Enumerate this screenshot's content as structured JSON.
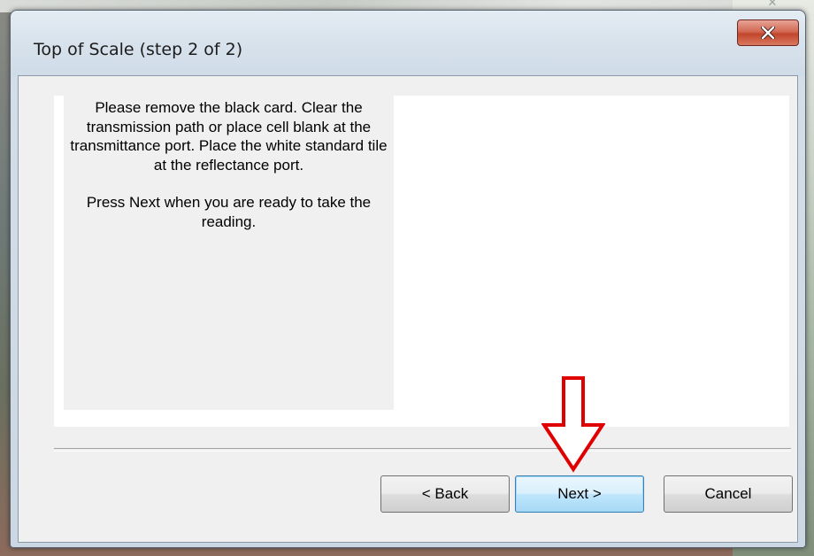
{
  "window": {
    "title": "Top of Scale (step 2 of 2)"
  },
  "instructions": {
    "paragraph1": "Please remove the black card.  Clear the transmission path or place cell blank at the transmittance port.  Place the white standard tile at the reflectance port.",
    "paragraph2": "Press Next when you are ready to take the reading."
  },
  "buttons": {
    "back_label": "< Back",
    "next_label": "Next >",
    "cancel_label": "Cancel"
  },
  "icons": {
    "close": "close-icon",
    "annotation": "down-arrow-icon"
  },
  "colors": {
    "annotation_arrow": "#e00000",
    "close_button": "#c2452c",
    "default_button_border": "#3c7fb1"
  }
}
